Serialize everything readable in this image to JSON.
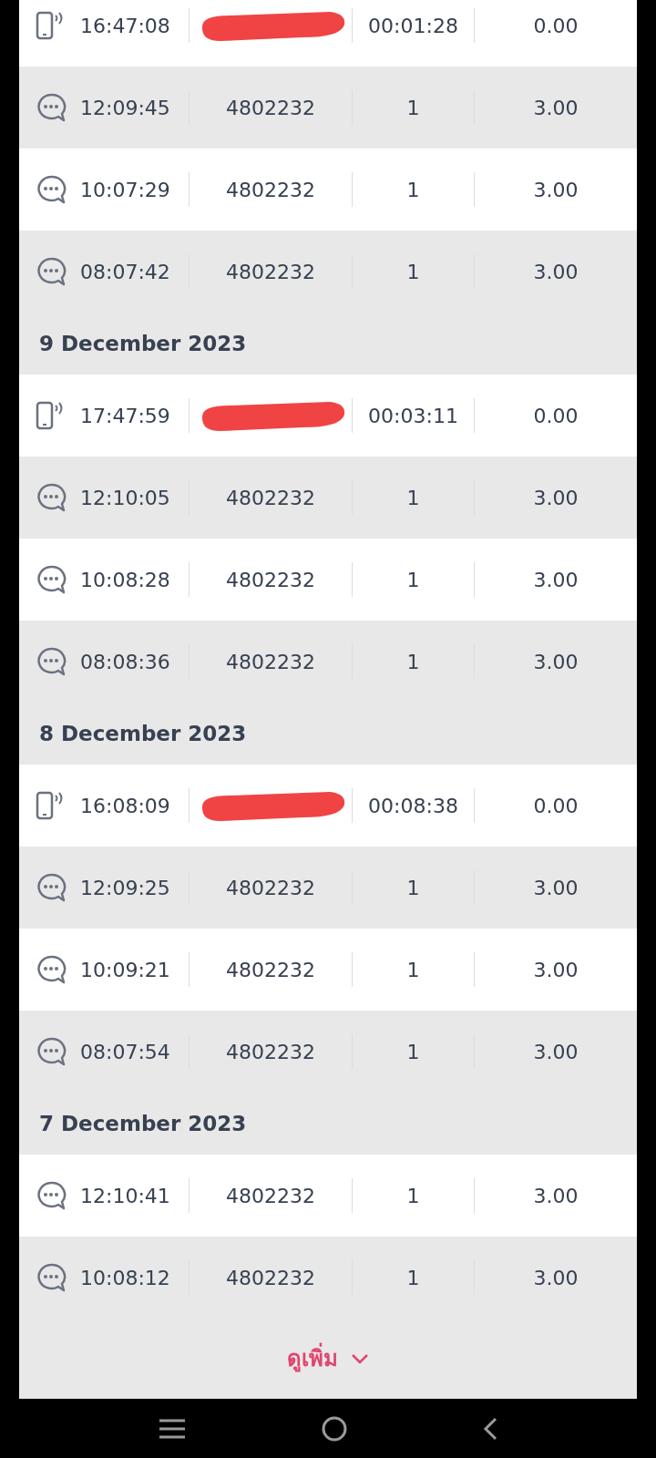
{
  "groups": [
    {
      "rows": [
        {
          "kind": "call",
          "time": "16:47:08",
          "redacted": true,
          "duration": "00:01:28",
          "charge": "0.00"
        },
        {
          "kind": "sms",
          "time": "12:09:45",
          "number": "4802232",
          "duration": "1",
          "charge": "3.00"
        },
        {
          "kind": "sms",
          "time": "10:07:29",
          "number": "4802232",
          "duration": "1",
          "charge": "3.00"
        },
        {
          "kind": "sms",
          "time": "08:07:42",
          "number": "4802232",
          "duration": "1",
          "charge": "3.00"
        }
      ]
    },
    {
      "date": "9 December 2023",
      "rows": [
        {
          "kind": "call",
          "time": "17:47:59",
          "redacted": true,
          "duration": "00:03:11",
          "charge": "0.00"
        },
        {
          "kind": "sms",
          "time": "12:10:05",
          "number": "4802232",
          "duration": "1",
          "charge": "3.00"
        },
        {
          "kind": "sms",
          "time": "10:08:28",
          "number": "4802232",
          "duration": "1",
          "charge": "3.00"
        },
        {
          "kind": "sms",
          "time": "08:08:36",
          "number": "4802232",
          "duration": "1",
          "charge": "3.00"
        }
      ]
    },
    {
      "date": "8 December 2023",
      "rows": [
        {
          "kind": "call",
          "time": "16:08:09",
          "redacted": true,
          "duration": "00:08:38",
          "charge": "0.00"
        },
        {
          "kind": "sms",
          "time": "12:09:25",
          "number": "4802232",
          "duration": "1",
          "charge": "3.00"
        },
        {
          "kind": "sms",
          "time": "10:09:21",
          "number": "4802232",
          "duration": "1",
          "charge": "3.00"
        },
        {
          "kind": "sms",
          "time": "08:07:54",
          "number": "4802232",
          "duration": "1",
          "charge": "3.00"
        }
      ]
    },
    {
      "date": "7 December 2023",
      "rows": [
        {
          "kind": "sms",
          "time": "12:10:41",
          "number": "4802232",
          "duration": "1",
          "charge": "3.00"
        },
        {
          "kind": "sms",
          "time": "10:08:12",
          "number": "4802232",
          "duration": "1",
          "charge": "3.00"
        }
      ]
    }
  ],
  "more_button": "ดูเพิ่ม"
}
